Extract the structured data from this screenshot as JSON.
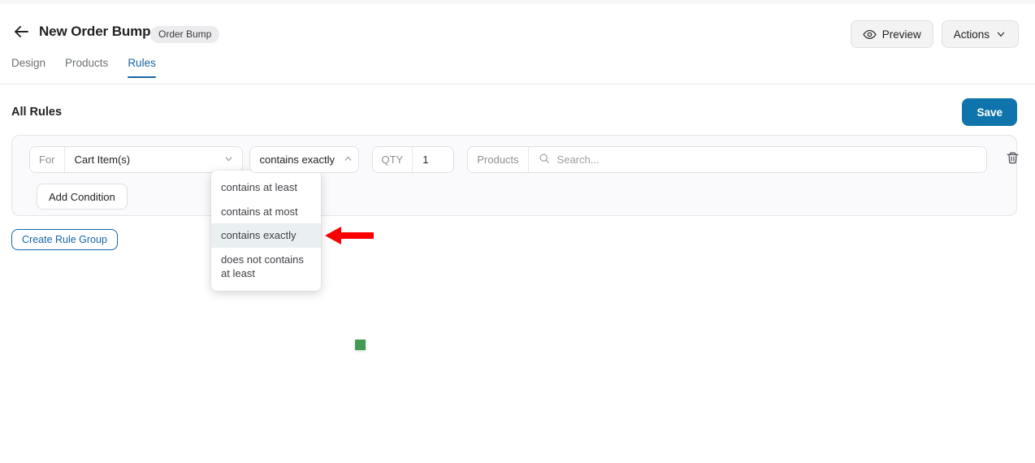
{
  "header": {
    "back_icon": "arrow-left-icon",
    "title": "New Order Bump",
    "badge": "Order Bump",
    "preview_label": "Preview",
    "preview_icon": "eye-icon",
    "actions_label": "Actions",
    "actions_icon": "chevron-down-icon"
  },
  "tabs": [
    {
      "label": "Design",
      "active": false
    },
    {
      "label": "Products",
      "active": false
    },
    {
      "label": "Rules",
      "active": true
    }
  ],
  "rules_section": {
    "title": "All Rules",
    "save_label": "Save",
    "add_condition_label": "Add Condition",
    "create_rule_group_label": "Create Rule Group"
  },
  "rule_row": {
    "for_label": "For",
    "subject_value": "Cart Item(s)",
    "subject_chevron": "chevron-down-icon",
    "operator_value": "contains exactly",
    "operator_chevron": "chevron-up-icon",
    "qty_label": "QTY",
    "qty_value": "1",
    "products_label": "Products",
    "search_icon": "search-icon",
    "search_placeholder": "Search...",
    "delete_icon": "trash-icon"
  },
  "operator_dropdown": {
    "options": [
      {
        "label": "contains at least",
        "selected": false
      },
      {
        "label": "contains at most",
        "selected": false
      },
      {
        "label": "contains exactly",
        "selected": true
      },
      {
        "label": "does not contains at least",
        "selected": false
      }
    ]
  },
  "annotations": {
    "arrow_color": "#fb0000",
    "arrow_direction": "left",
    "marker_color": "#449a52"
  },
  "colors": {
    "accent_blue": "#1566a8",
    "save_blue": "#0e74ab",
    "card_bg": "#fafafc",
    "highlight": "#eaeff1"
  }
}
